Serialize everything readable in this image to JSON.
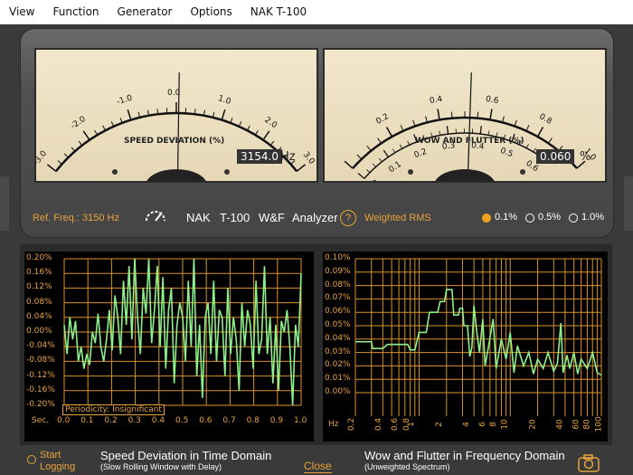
{
  "menu": [
    "View",
    "Function",
    "Generator",
    "Options",
    "NAK T-100"
  ],
  "meter_left": {
    "title": "SPEED DEVIATION (%)",
    "scale": [
      "-3.0",
      "-2.0",
      "-1.0",
      "0.0",
      "1.0",
      "2.0",
      "3.0"
    ],
    "readout": "3154.0",
    "unit": "Hz",
    "needle_value": 0.05
  },
  "meter_right": {
    "title": "WOW AND FLUTTER (%)",
    "scale_outer": [
      "0.2",
      "0.4",
      "0.6",
      "0.8",
      "1.0"
    ],
    "scale_inner": [
      "0.0",
      "0.1",
      "0.2",
      "0.3",
      "0.4",
      "0.5",
      "0.6"
    ],
    "readout": "0.060",
    "unit": "%",
    "needle_value": 0.06
  },
  "info": {
    "ref_freq": "Ref. Freq.: 3150 Hz",
    "brand": "NAK",
    "model": "T-100",
    "wf": "W&F",
    "analyzer": "Analyzer",
    "help": "?",
    "weighting": "Weighted RMS",
    "ranges": [
      "0.1%",
      "0.5%",
      "1.0%"
    ],
    "selected_range": "0.1%"
  },
  "graph_left": {
    "y_ticks": [
      "0.20%",
      "0.16%",
      "0.12%",
      "0.08%",
      "0.04%",
      "0.00%",
      "-0.04%",
      "-0.08%",
      "-0.12%",
      "-0.16%",
      "-0.20%"
    ],
    "x_ticks": [
      "0.0",
      "0.1",
      "0.2",
      "0.3",
      "0.4",
      "0.5",
      "0.6",
      "0.7",
      "0.8",
      "0.9",
      "1.0"
    ],
    "x_unit": "Sec.",
    "periodicity": "Periodicity: Insignificant"
  },
  "graph_right": {
    "y_ticks": [
      "0.10%",
      "0.09%",
      "0.08%",
      "0.07%",
      "0.06%",
      "0.05%",
      "0.04%",
      "0.03%",
      "0.02%",
      "0.01%",
      "0.00%"
    ],
    "x_ticks": [
      "0.2",
      "0.4",
      "0.6",
      "0.8",
      "1",
      "2",
      "4",
      "6",
      "8",
      "10",
      "20",
      "40",
      "60",
      "80",
      "100"
    ],
    "x_unit": "Hz"
  },
  "chart_data": [
    {
      "type": "line",
      "xlabel": "Sec.",
      "xlim": [
        0,
        1.0
      ],
      "ylim": [
        -0.2,
        0.2
      ],
      "series": [
        {
          "values": [
            0.02,
            -0.06,
            0.04,
            -0.02,
            0.03,
            -0.08,
            -0.04,
            -0.1,
            -0.06,
            -0.09,
            0.0,
            -0.03,
            0.05,
            -0.04,
            -0.08,
            -0.02,
            0.06,
            -0.05,
            0.1,
            0.04,
            -0.06,
            0.14,
            0.02,
            0.18,
            -0.02,
            0.2,
            0.04,
            -0.06,
            0.12,
            0.05,
            0.2,
            -0.03,
            0.06,
            0.18,
            -0.04,
            0.15,
            -0.1,
            0.06,
            0.12,
            -0.14,
            0.02,
            0.08,
            0.04,
            -0.08,
            0.14,
            -0.04,
            0.2,
            -0.12,
            0.02,
            -0.18,
            0.04,
            0.08,
            -0.06,
            0.14,
            -0.08,
            0.06,
            0.04,
            -0.12,
            0.12,
            -0.06,
            0.04,
            -0.02,
            -0.16,
            0.08,
            -0.04,
            0.06,
            0.02,
            -0.1,
            0.14,
            -0.06,
            -0.02,
            0.18,
            -0.06,
            0.04,
            -0.14,
            0.02,
            -0.16,
            0.03,
            0.0,
            0.06,
            -0.04,
            -0.2,
            0.02,
            -0.04,
            0.16
          ]
        }
      ]
    },
    {
      "type": "line",
      "xlabel": "Hz",
      "xscale": "log",
      "xlim": [
        0.2,
        100
      ],
      "ylim": [
        0,
        0.1
      ],
      "series": [
        {
          "points": [
            [
              0.2,
              0.038
            ],
            [
              0.3,
              0.038
            ],
            [
              0.31,
              0.033
            ],
            [
              0.4,
              0.033
            ],
            [
              0.45,
              0.036
            ],
            [
              0.75,
              0.036
            ],
            [
              0.8,
              0.032
            ],
            [
              0.9,
              0.032
            ],
            [
              1.0,
              0.045
            ],
            [
              1.2,
              0.045
            ],
            [
              1.3,
              0.06
            ],
            [
              1.6,
              0.06
            ],
            [
              1.7,
              0.068
            ],
            [
              1.9,
              0.068
            ],
            [
              2.0,
              0.077
            ],
            [
              2.3,
              0.077
            ],
            [
              2.4,
              0.058
            ],
            [
              2.7,
              0.058
            ],
            [
              2.8,
              0.063
            ],
            [
              3.0,
              0.063
            ],
            [
              3.1,
              0.05
            ],
            [
              3.4,
              0.05
            ],
            [
              3.6,
              0.027
            ],
            [
              3.8,
              0.034
            ],
            [
              4.0,
              0.065
            ],
            [
              4.3,
              0.045
            ],
            [
              4.6,
              0.03
            ],
            [
              5.0,
              0.055
            ],
            [
              5.3,
              0.02
            ],
            [
              5.8,
              0.035
            ],
            [
              6.5,
              0.055
            ],
            [
              7,
              0.018
            ],
            [
              8,
              0.04
            ],
            [
              9,
              0.025
            ],
            [
              10,
              0.045
            ],
            [
              11,
              0.015
            ],
            [
              12,
              0.035
            ],
            [
              14,
              0.02
            ],
            [
              16,
              0.03
            ],
            [
              18,
              0.014
            ],
            [
              20,
              0.025
            ],
            [
              23,
              0.018
            ],
            [
              26,
              0.03
            ],
            [
              30,
              0.016
            ],
            [
              33,
              0.022
            ],
            [
              36,
              0.052
            ],
            [
              38,
              0.015
            ],
            [
              42,
              0.028
            ],
            [
              45,
              0.018
            ],
            [
              50,
              0.03
            ],
            [
              55,
              0.014
            ],
            [
              60,
              0.025
            ],
            [
              70,
              0.018
            ],
            [
              80,
              0.03
            ],
            [
              90,
              0.015
            ],
            [
              100,
              0.013
            ]
          ]
        }
      ]
    }
  ],
  "footer": {
    "start_logging_line1": "Start",
    "start_logging_line2": "Logging",
    "left_title": "Speed Deviation in Time Domain",
    "left_sub": "(Slow Rolling Window with Delay)",
    "close": "Close",
    "right_title": "Wow and Flutter in Frequency Domain",
    "right_sub": "(Unweighted Spectrum)"
  }
}
